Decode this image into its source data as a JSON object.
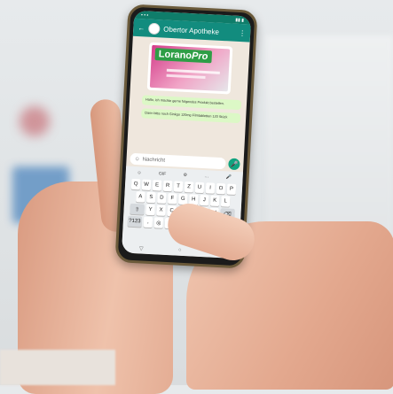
{
  "chat": {
    "title": "Obertor Apotheke",
    "status_time": "",
    "messages": [
      "Hallo, ich möchte gerne folgendes Produkt bestellen.",
      "Dann bitte noch Ginkgo 120mg Filmtabletten 120 Stück"
    ]
  },
  "promo": {
    "brand": "Lorano",
    "brand_suffix": "Pro"
  },
  "input": {
    "placeholder": "Nachricht"
  },
  "keyboard": {
    "toolbar": [
      "☺",
      "GIF",
      "⚙",
      "…",
      "🎤"
    ],
    "row1": [
      "Q",
      "W",
      "E",
      "R",
      "T",
      "Z",
      "U",
      "I",
      "O",
      "P"
    ],
    "row2": [
      "A",
      "S",
      "D",
      "F",
      "G",
      "H",
      "J",
      "K",
      "L"
    ],
    "row3": [
      "Y",
      "X",
      "C",
      "V",
      "B",
      "N",
      "M"
    ],
    "row4_left": "?123",
    "row4_comma": ",",
    "row4_dot": "."
  },
  "colors": {
    "header": "#128c7e",
    "bubble": "#dcf8c6",
    "brand": "#2e9e46"
  }
}
